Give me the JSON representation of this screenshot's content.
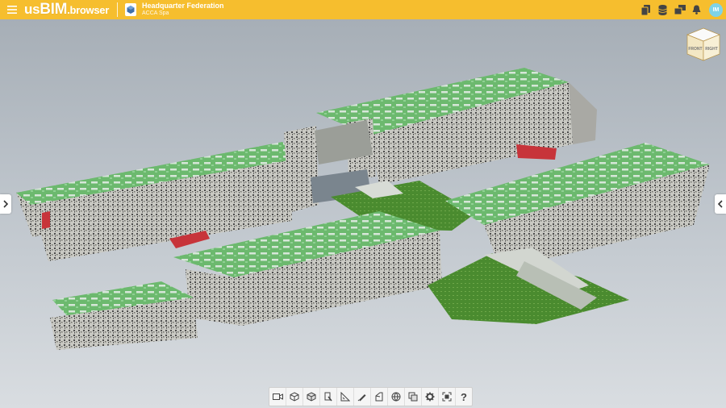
{
  "header": {
    "logo_us": "us",
    "logo_bim": "BIM",
    "logo_browser": ".browser",
    "project_name": "Headquarter Federation",
    "project_sub": "ACCA Spa",
    "avatar_initials": "IM",
    "tools": [
      "layers-icon",
      "database-icon",
      "models-icon",
      "bell-icon"
    ]
  },
  "viewcube": {
    "left": "FRONT",
    "right": "RIGHT"
  },
  "toolbar": {
    "tools": [
      "camera-icon",
      "box-view-icon",
      "section-box-icon",
      "walk-icon",
      "measure-icon",
      "markup-icon",
      "clip-icon",
      "globe-icon",
      "compare-icon",
      "settings-icon",
      "fit-view-icon"
    ],
    "help_label": "?"
  },
  "colors": {
    "accent": "#f6be2e",
    "roof": "#6dbb6f",
    "wall": "#c8c8c4",
    "grass": "#4f8a2e"
  }
}
